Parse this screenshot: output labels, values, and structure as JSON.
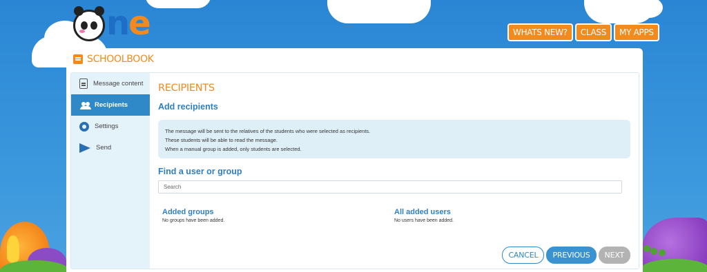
{
  "logo": {
    "letters_blue": "n",
    "letters_orange": "e"
  },
  "topnav": [
    {
      "label": "WHATS NEW?"
    },
    {
      "label": "CLASS"
    },
    {
      "label": "MY APPS"
    }
  ],
  "app": {
    "title": "SCHOOLBOOK",
    "icon": "schoolbook-icon"
  },
  "sidebar": {
    "items": [
      {
        "label": "Message content",
        "icon": "document-icon",
        "active": false
      },
      {
        "label": "Recipients",
        "icon": "add-users-icon",
        "active": true
      },
      {
        "label": "Settings",
        "icon": "gear-icon",
        "active": false
      },
      {
        "label": "Send",
        "icon": "send-icon",
        "active": false
      }
    ]
  },
  "main": {
    "heading": "RECIPIENTS",
    "add_title": "Add recipients",
    "info_lines": [
      "The message will be sent to the relatives of the students who were selected as recipients.",
      "These students will be able to read the message.",
      "When a manual group is added, only students are selected."
    ],
    "find_title": "Find a user or group",
    "search": {
      "placeholder": "Search",
      "value": ""
    },
    "added_groups": {
      "title": "Added groups",
      "empty": "No groups have been added."
    },
    "added_users": {
      "title": "All added users",
      "empty": "No users have been added."
    }
  },
  "actions": {
    "cancel": "CANCEL",
    "previous": "PREVIOUS",
    "next": "NEXT"
  },
  "colors": {
    "accent_orange": "#f28a1e",
    "primary_blue": "#2f88c8",
    "sidebar_bg": "#e4f2fa",
    "disabled_grey": "#b3b3b3"
  }
}
